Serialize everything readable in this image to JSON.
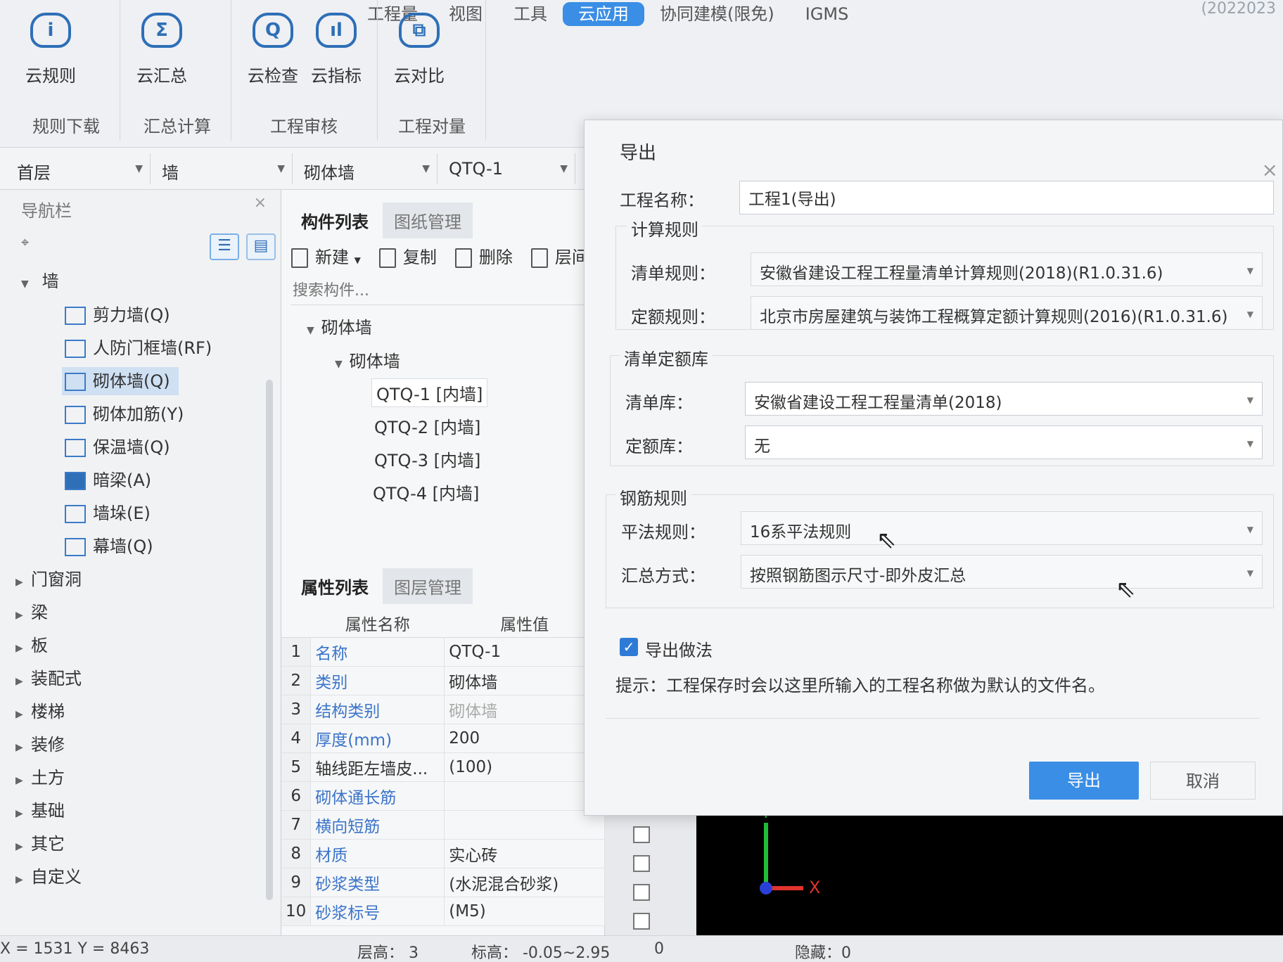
{
  "menu_tabs": [
    {
      "label": "工程量",
      "active": false
    },
    {
      "label": "视图",
      "active": false
    },
    {
      "label": "工具",
      "active": false
    },
    {
      "label": "云应用",
      "active": true
    },
    {
      "label": "协同建模(限免)",
      "active": false
    },
    {
      "label": "IGMS",
      "active": false
    }
  ],
  "window_title_fragment": "(2022023",
  "ribbon": {
    "buttons": [
      {
        "label": "云规则",
        "icon": "info-icon",
        "glyph": "i"
      },
      {
        "label": "云汇总",
        "icon": "sigma-icon",
        "glyph": "Σ"
      },
      {
        "label": "云检查",
        "icon": "magnifier-icon",
        "glyph": "Q"
      },
      {
        "label": "云指标",
        "icon": "bar-chart-icon",
        "glyph": "ıl"
      },
      {
        "label": "云对比",
        "icon": "compare-icon",
        "glyph": "⧉"
      }
    ],
    "groups": [
      "规则下载",
      "汇总计算",
      "工程审核",
      "工程对量"
    ]
  },
  "selectors": {
    "floor": "首层",
    "category": "墙",
    "type": "砌体墙",
    "component": "QTQ-1"
  },
  "nav": {
    "title": "导航栏",
    "close": "×",
    "pin": "⌖",
    "wall_group": "墙",
    "wall_items": [
      {
        "label": "剪力墙(Q)",
        "icon": "shear-wall-icon",
        "selected": false
      },
      {
        "label": "人防门框墙(RF)",
        "icon": "door-frame-wall-icon",
        "selected": false
      },
      {
        "label": "砌体墙(Q)",
        "icon": "masonry-wall-icon",
        "selected": true
      },
      {
        "label": "砌体加筋(Y)",
        "icon": "masonry-rebar-icon",
        "selected": false
      },
      {
        "label": "保温墙(Q)",
        "icon": "insulation-wall-icon",
        "selected": false
      },
      {
        "label": "暗梁(A)",
        "icon": "hidden-beam-icon",
        "selected": false
      },
      {
        "label": "墙垛(E)",
        "icon": "wall-pier-icon",
        "selected": false
      },
      {
        "label": "幕墙(Q)",
        "icon": "curtain-wall-icon",
        "selected": false
      }
    ],
    "groups": [
      "门窗洞",
      "梁",
      "板",
      "装配式",
      "楼梯",
      "装修",
      "土方",
      "基础",
      "其它",
      "自定义"
    ]
  },
  "component_panel": {
    "tabs": [
      "构件列表",
      "图纸管理"
    ],
    "toolbar": [
      "新建",
      "复制",
      "删除",
      "层间"
    ],
    "search_placeholder": "搜索构件...",
    "tree_root": "砌体墙",
    "tree_child": "砌体墙",
    "items": [
      "QTQ-1 [内墙]",
      "QTQ-2 [内墙]",
      "QTQ-3 [内墙]",
      "QTQ-4 [内墙]"
    ]
  },
  "property_panel": {
    "tabs": [
      "属性列表",
      "图层管理"
    ],
    "col_name": "属性名称",
    "col_value": "属性值",
    "rows": [
      {
        "idx": "1",
        "name": "名称",
        "value": "QTQ-1",
        "blue": true
      },
      {
        "idx": "2",
        "name": "类别",
        "value": "砌体墙",
        "blue": true
      },
      {
        "idx": "3",
        "name": "结构类别",
        "value": "砌体墙",
        "blue": true
      },
      {
        "idx": "4",
        "name": "厚度(mm)",
        "value": "200",
        "blue": true
      },
      {
        "idx": "5",
        "name": "轴线距左墙皮...",
        "value": "(100)",
        "blue": false
      },
      {
        "idx": "6",
        "name": "砌体通长筋",
        "value": "",
        "blue": true
      },
      {
        "idx": "7",
        "name": "横向短筋",
        "value": "",
        "blue": true
      },
      {
        "idx": "8",
        "name": "材质",
        "value": "实心砖",
        "blue": true
      },
      {
        "idx": "9",
        "name": "砂浆类型",
        "value": "(水泥混合砂浆)",
        "blue": true
      },
      {
        "idx": "10",
        "name": "砂浆标号",
        "value": "(M5)",
        "blue": true
      }
    ]
  },
  "canvas": {
    "axis_y": "Y",
    "axis_x": "X"
  },
  "status_bar": {
    "coords": "X = 1531 Y = 8463",
    "floor_height": "层高： 3",
    "elevation": "标高： -0.05~2.95",
    "zero": "0",
    "hidden": "隐藏：0"
  },
  "dialog": {
    "title": "导出",
    "close": "×",
    "project_name_label": "工程名称：",
    "project_name_value": "工程1(导出)",
    "calc_rules_title": "计算规则",
    "bill_rule_label": "清单规则：",
    "bill_rule_value": "安徽省建设工程工程量清单计算规则(2018)(R1.0.31.6)",
    "quota_rule_label": "定额规则：",
    "quota_rule_value": "北京市房屋建筑与装饰工程概算定额计算规则(2016)(R1.0.31.6)",
    "library_title": "清单定额库",
    "bill_lib_label": "清单库：",
    "bill_lib_value": "安徽省建设工程工程量清单(2018)",
    "quota_lib_label": "定额库：",
    "quota_lib_value": "无",
    "rebar_title": "钢筋规则",
    "flat_rule_label": "平法规则：",
    "flat_rule_value": "16系平法规则",
    "summary_label": "汇总方式：",
    "summary_value": "按照钢筋图示尺寸-即外皮汇总",
    "export_method_label": "导出做法",
    "export_method_checked": true,
    "hint": "提示：工程保存时会以这里所输入的工程名称做为默认的文件名。",
    "export_button": "导出",
    "cancel_button": "取消"
  }
}
